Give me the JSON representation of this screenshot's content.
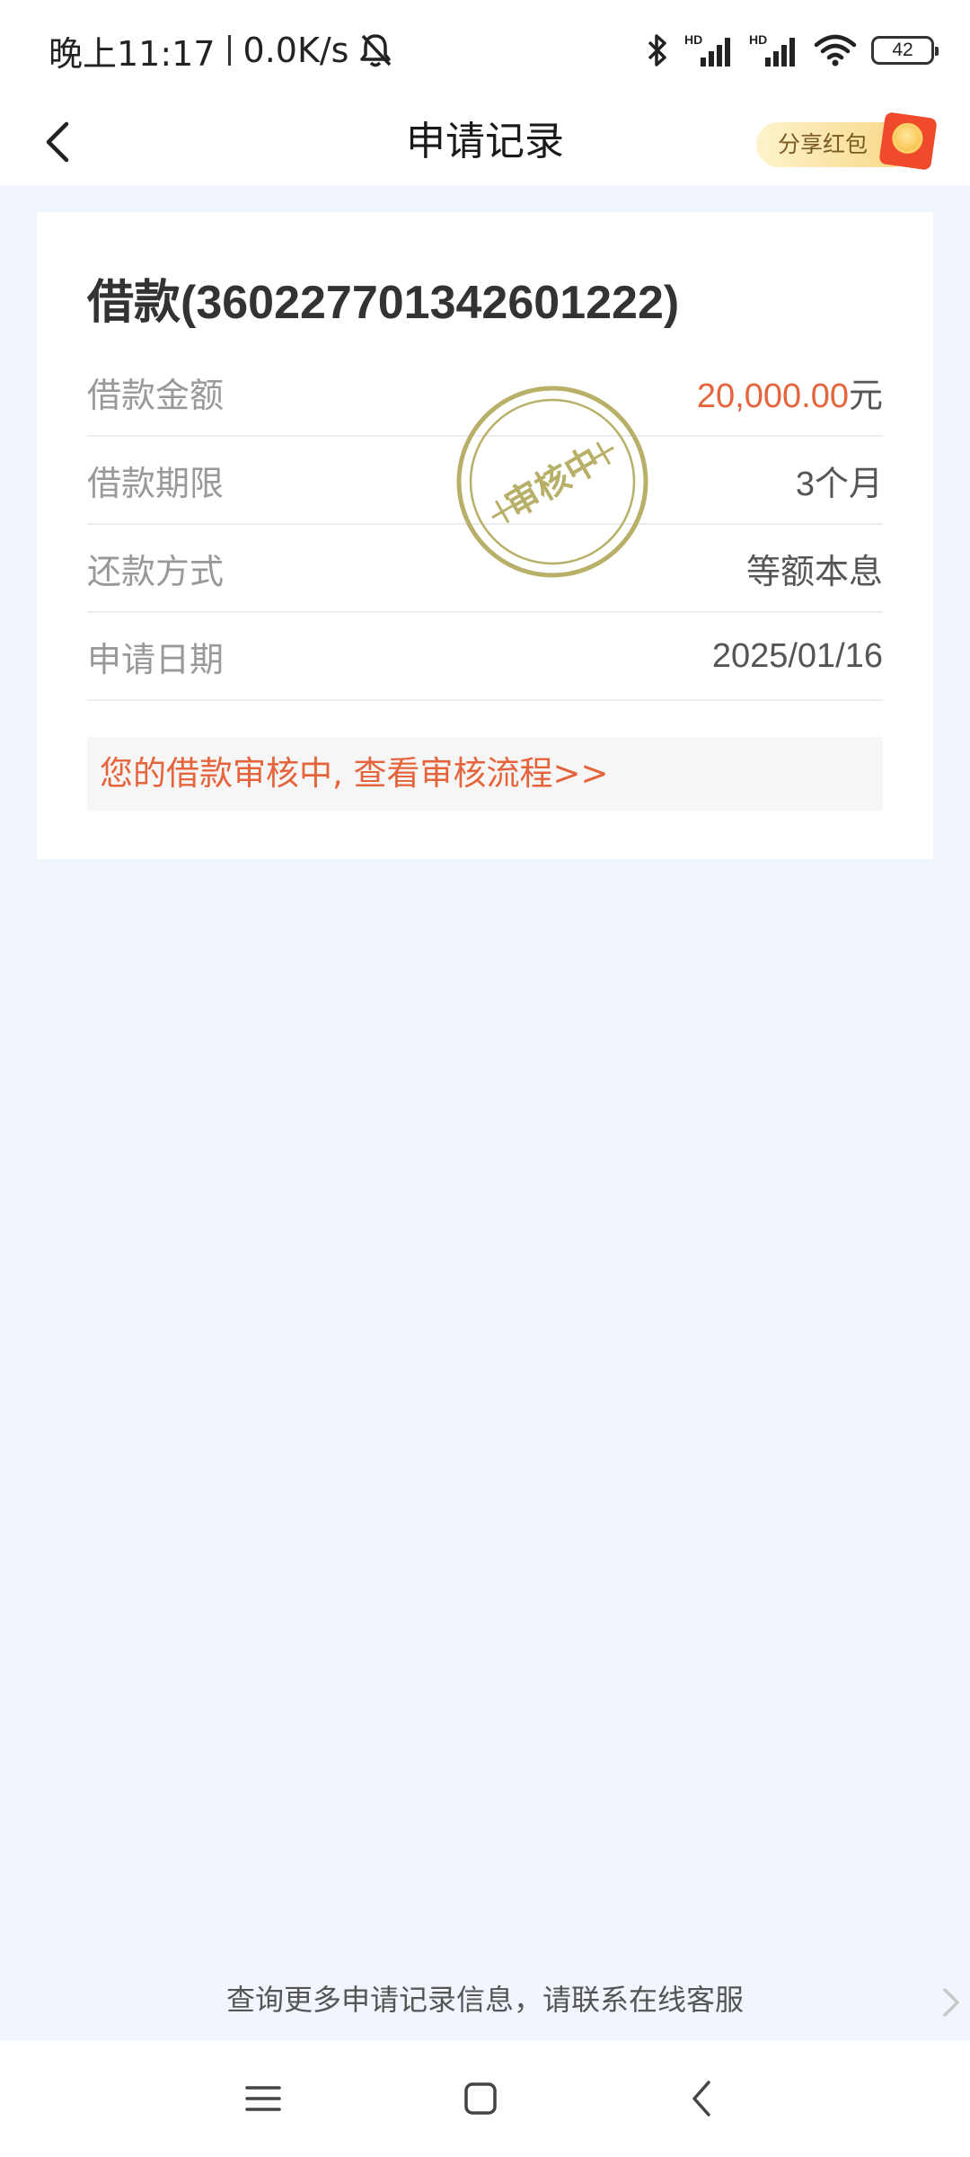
{
  "status_bar": {
    "time": "晚上11:17",
    "net_speed": "0.0K/s",
    "battery": "42",
    "hd1": "HD",
    "hd2": "HD",
    "icons": [
      "mute-bell-icon",
      "bluetooth-icon",
      "signal-icon",
      "wifi-icon",
      "battery-icon"
    ]
  },
  "nav": {
    "title": "申请记录",
    "share_label": "分享红包",
    "back_icon": "chevron-left-icon"
  },
  "record": {
    "title": "借款(360227701342601222)",
    "rows": [
      {
        "label": "借款金额",
        "value": "20,000.00",
        "unit": "元"
      },
      {
        "label": "借款期限",
        "value": "3个月"
      },
      {
        "label": "还款方式",
        "value": "等额本息"
      },
      {
        "label": "申请日期",
        "value": "2025/01/16"
      }
    ],
    "stamp_text": "审核中",
    "notice": "您的借款审核中, 查看审核流程>>"
  },
  "footer": {
    "hint": "查询更多申请记录信息，请联系在线客服"
  },
  "colors": {
    "accent": "#e5643c",
    "stamp": "#b8b068",
    "background": "#f1f5fd"
  }
}
